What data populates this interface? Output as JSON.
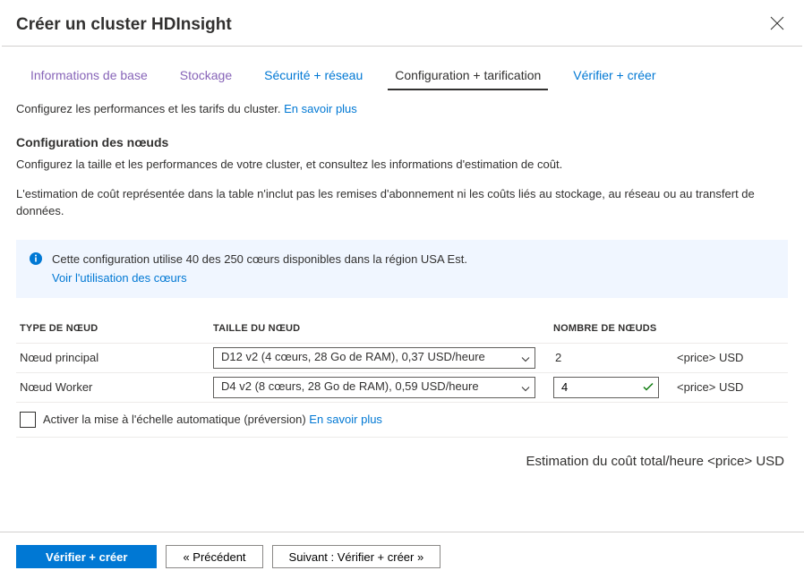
{
  "header": {
    "title": "Créer un cluster HDInsight"
  },
  "tabs": {
    "basics": "Informations de base",
    "storage": "Stockage",
    "security": "Sécurité + réseau",
    "config": "Configuration + tarification",
    "review": "Vérifier + créer"
  },
  "intro": {
    "text": "Configurez les performances et les tarifs du cluster. ",
    "learn_more": "En savoir plus"
  },
  "nodes_section": {
    "title": "Configuration des nœuds",
    "text1": "Configurez la taille et les performances de votre cluster, et consultez les informations d'estimation de coût.",
    "text2": "L'estimation de coût représentée dans la table n'inclut pas les remises d'abonnement ni les coûts liés au stockage, au réseau ou au transfert de données."
  },
  "info_box": {
    "text": "Cette configuration utilise 40 des 250 cœurs disponibles dans la région USA Est.",
    "link": "Voir l'utilisation des cœurs"
  },
  "table": {
    "header_type": "TYPE DE NŒUD",
    "header_size": "TAILLE DU NŒUD",
    "header_count": "NOMBRE DE NŒUDS",
    "rows": [
      {
        "type": "Nœud principal",
        "size": "D12 v2 (4 cœurs, 28 Go de RAM), 0,37 USD/heure",
        "count": "2",
        "cost": "<price> USD"
      },
      {
        "type": "Nœud Worker",
        "size": "D4 v2 (8 cœurs, 28 Go de RAM), 0,59 USD/heure",
        "count": "4",
        "cost": "<price> USD"
      }
    ]
  },
  "autoscale": {
    "label": "Activer la mise à l'échelle automatique (préversion) ",
    "learn_more": "En savoir plus"
  },
  "total": {
    "label": "Estimation du coût total/heure ",
    "value": "<price> USD"
  },
  "footer": {
    "review_create": "Vérifier + créer",
    "previous": "«  Précédent",
    "next": "Suivant : Vérifier + créer   »"
  }
}
